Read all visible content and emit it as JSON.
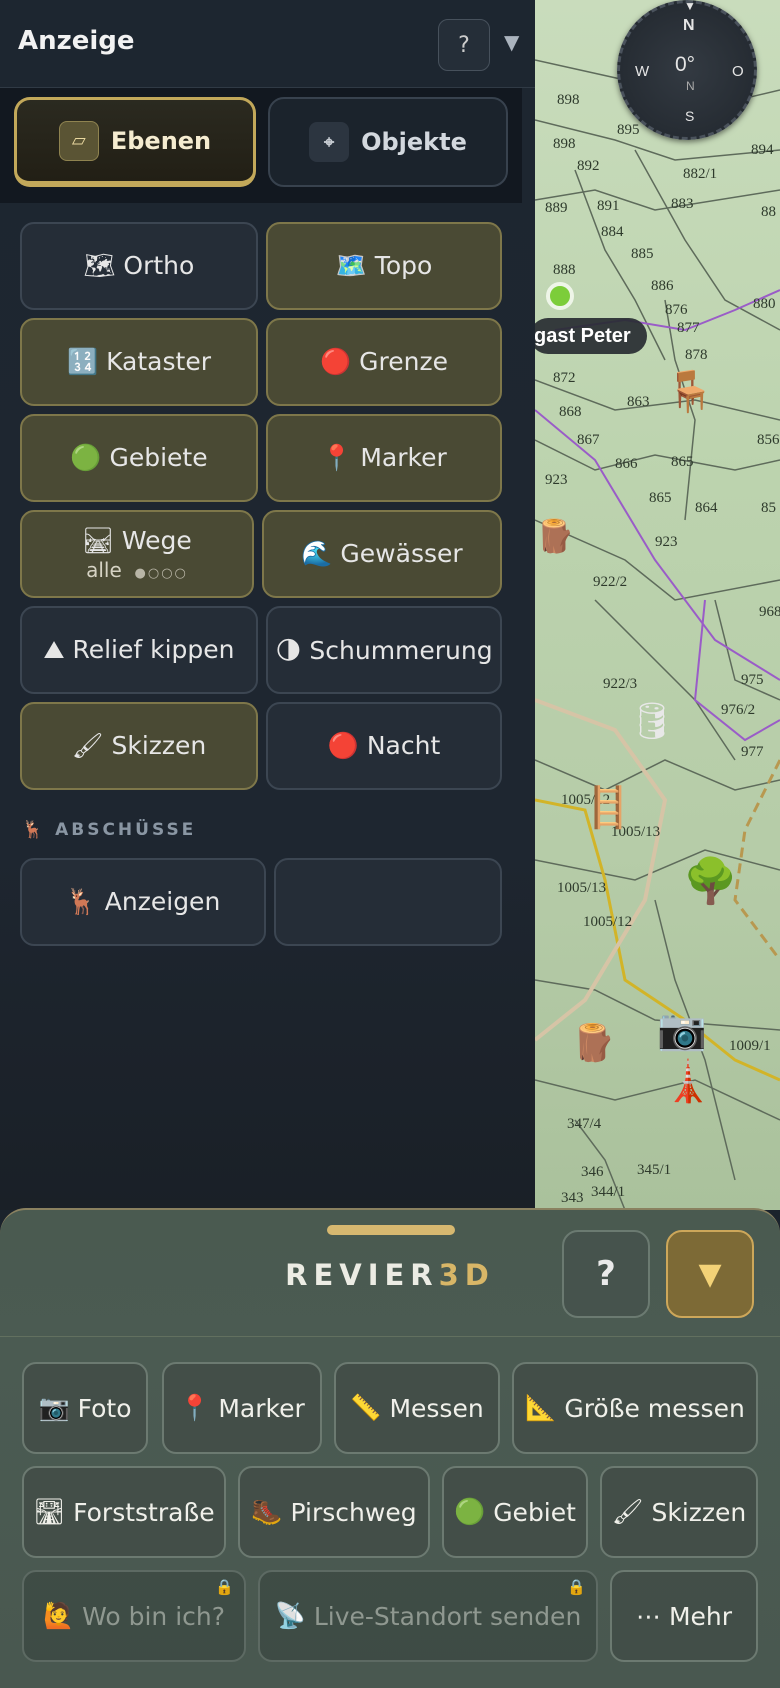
{
  "panel": {
    "title": "Anzeige",
    "help": "?",
    "collapse": "▼",
    "segments": [
      {
        "icon": "▱",
        "label": "Ebenen",
        "active": true
      },
      {
        "icon": "⌖",
        "label": "Objekte",
        "active": false
      }
    ],
    "layers": [
      {
        "icon": "🗺",
        "label": "Ortho",
        "on": false
      },
      {
        "icon": "🗺️",
        "label": "Topo",
        "on": true
      },
      {
        "icon": "🔢",
        "label": "Kataster",
        "on": true
      },
      {
        "icon": "🔴",
        "label": "Grenze",
        "on": true
      },
      {
        "icon": "🟢",
        "label": "Gebiete",
        "on": true
      },
      {
        "icon": "📍",
        "label": "Marker",
        "on": true
      },
      {
        "icon": "🛤",
        "label": "Wege",
        "sub": "alle",
        "dots": "●○○○",
        "on": true
      },
      {
        "icon": "🌊",
        "label": "Gewässer",
        "on": true
      },
      {
        "icon": "⛰",
        "label": "Relief kippen",
        "on": false
      },
      {
        "icon": "🌗",
        "label": "Schummerung",
        "on": false
      },
      {
        "icon": "🖌",
        "label": "Skizzen",
        "on": true
      },
      {
        "icon": "🔴",
        "label": "Nacht",
        "on": false
      }
    ],
    "section_icon": "🦌",
    "section_label": "ABSCHÜSSE",
    "abschuesse_button": {
      "icon": "🦌",
      "label": "Anzeigen"
    }
  },
  "map": {
    "compass": {
      "north": "N",
      "west": "W",
      "east": "O",
      "south": "S",
      "heading": "0°",
      "sub": "N"
    },
    "place_label": "gast Peter",
    "parcels": [
      "898",
      "895",
      "898",
      "892",
      "882/1",
      "894",
      "889",
      "891",
      "883",
      "88",
      "884",
      "885",
      "888",
      "886",
      "880",
      "876",
      "877",
      "878",
      "872",
      "868",
      "863",
      "867",
      "866",
      "865",
      "856",
      "923",
      "865",
      "864",
      "85",
      "923",
      "922/2",
      "968",
      "922/3",
      "975",
      "976/2",
      "977",
      "1005/12",
      "1005/13",
      "1005/13",
      "1005/12",
      "1009/1",
      "347/4",
      "346",
      "345/1",
      "344/1",
      "343"
    ]
  },
  "sheet": {
    "brand_main": "REVIER",
    "brand_accent": "3D",
    "help": "?",
    "collapse": "▼",
    "tools": [
      {
        "icon": "📷",
        "label": "Foto"
      },
      {
        "icon": "📍",
        "label": "Marker"
      },
      {
        "icon": "📏",
        "label": "Messen"
      },
      {
        "icon": "📐",
        "label": "Größe messen"
      },
      {
        "icon": "🛣",
        "label": "Forststraße"
      },
      {
        "icon": "🥾",
        "label": "Pirschweg"
      },
      {
        "icon": "🟢",
        "label": "Gebiet"
      },
      {
        "icon": "🖌",
        "label": "Skizzen"
      },
      {
        "icon": "🙋",
        "label": "Wo bin ich?",
        "locked": true
      },
      {
        "icon": "📡",
        "label": "Live-Standort senden",
        "locked": true
      },
      {
        "icon": "⋯",
        "label": "Mehr"
      }
    ],
    "lock_icon": "🔒"
  }
}
